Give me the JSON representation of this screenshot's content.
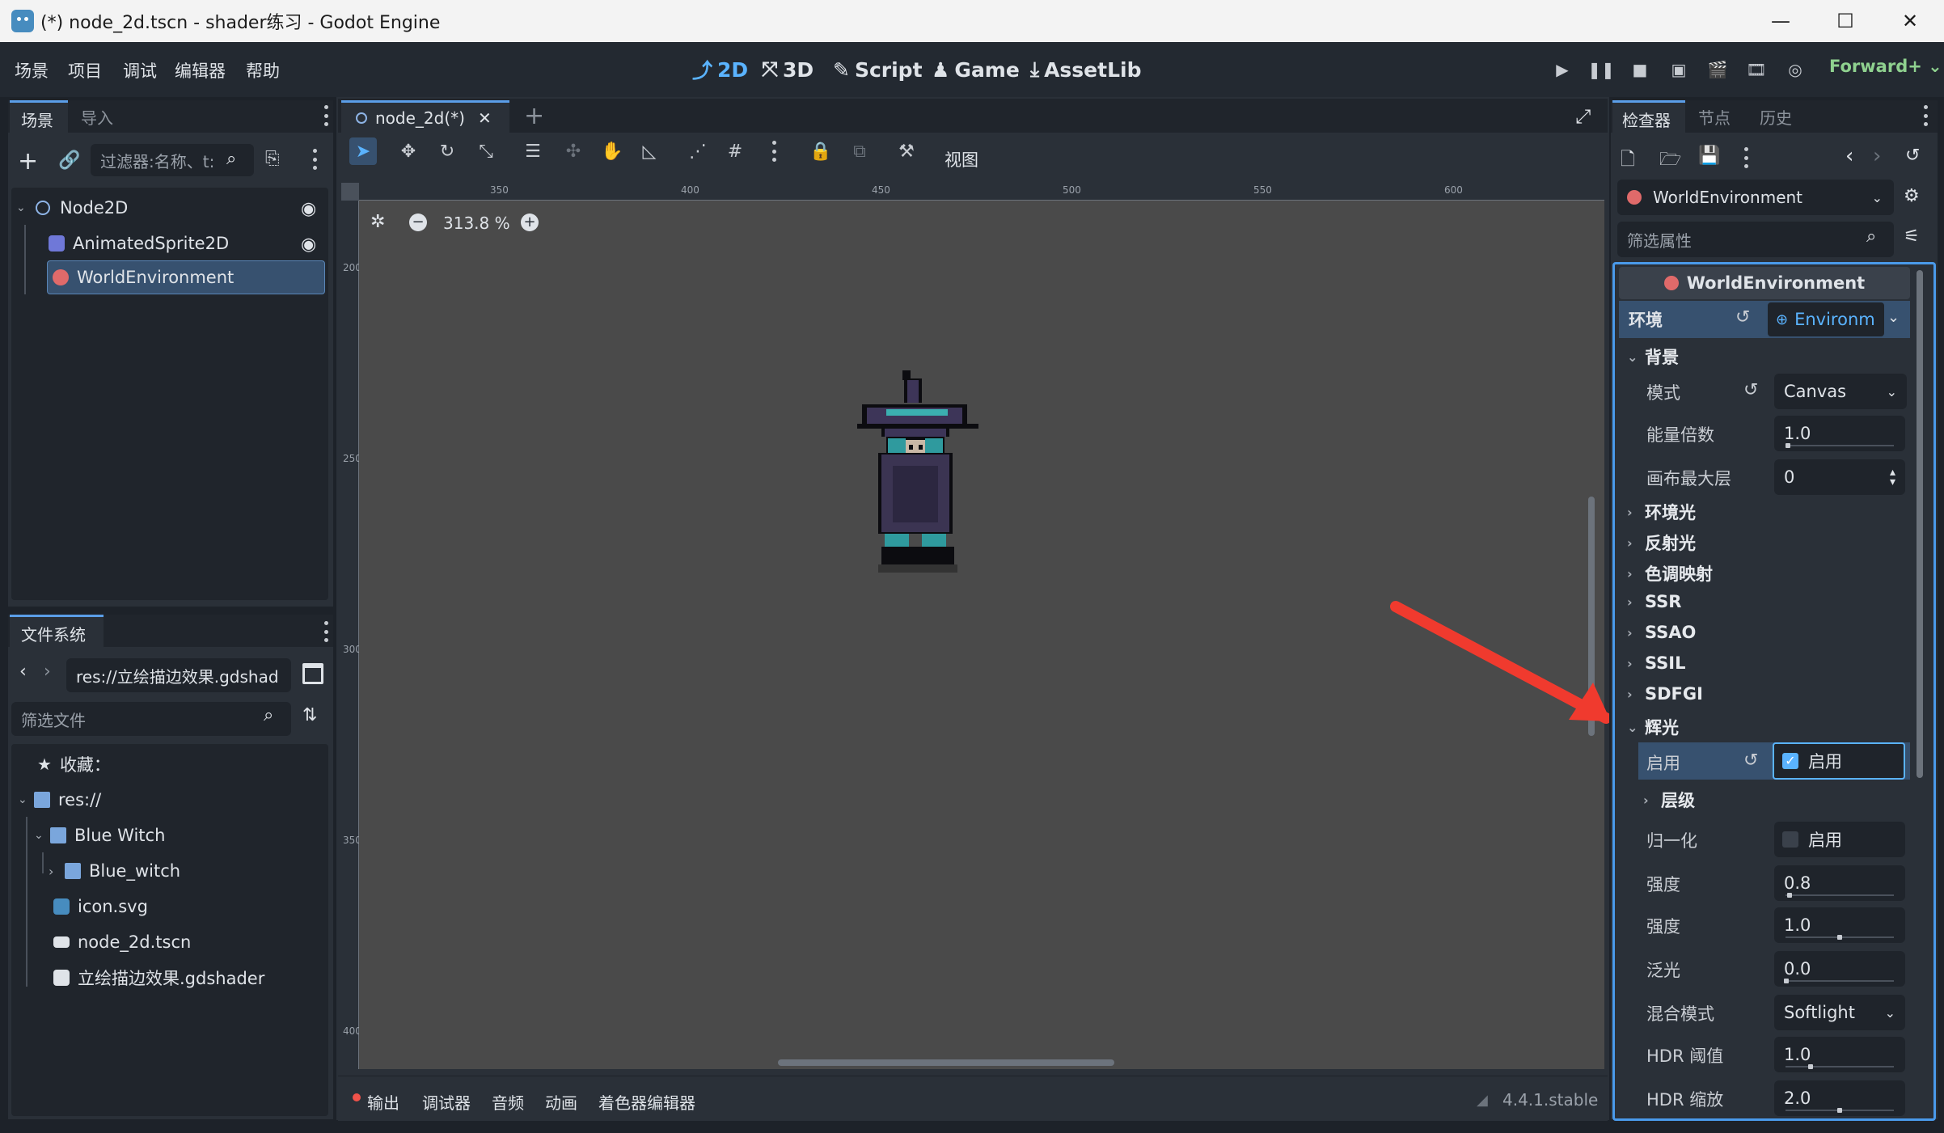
{
  "window": {
    "title": "(*) node_2d.tscn - shader练习 - Godot Engine"
  },
  "menu": {
    "items": [
      "场景",
      "项目",
      "调试",
      "编辑器",
      "帮助"
    ]
  },
  "workspaces": {
    "d2": "2D",
    "d3": "3D",
    "script": "Script",
    "game": "Game",
    "assetlib": "AssetLib"
  },
  "renderer": "Forward+",
  "scene_dock": {
    "tabs": [
      "场景",
      "导入"
    ],
    "filter_placeholder": "过滤器:名称、t:",
    "tree": [
      "Node2D",
      "AnimatedSprite2D",
      "WorldEnvironment"
    ],
    "selected": "WorldEnvironment"
  },
  "filesystem_dock": {
    "tab": "文件系统",
    "path": "res://立绘描边效果.gdshad",
    "filter_placeholder": "筛选文件",
    "favorites": "收藏：",
    "items": [
      "res://",
      "Blue Witch",
      "Blue_witch",
      "icon.svg",
      "node_2d.tscn",
      "立绘描边效果.gdshader"
    ]
  },
  "editor_tabs": {
    "scene_tab": "node_2d(*)"
  },
  "toolbar": {
    "view_label": "视图"
  },
  "viewport": {
    "zoom": "313.8 %",
    "ruler_h": [
      "350",
      "400",
      "450",
      "500",
      "550",
      "600"
    ],
    "ruler_v": [
      "200",
      "250",
      "300",
      "350",
      "400"
    ]
  },
  "bottom_panel": {
    "tabs": [
      "输出",
      "调试器",
      "音频",
      "动画",
      "着色器编辑器"
    ],
    "version": "4.4.1.stable"
  },
  "inspector": {
    "tabs": [
      "检查器",
      "节点",
      "历史"
    ],
    "object": "WorldEnvironment",
    "filter_placeholder": "筛选属性",
    "header": "WorldEnvironment",
    "environment_label": "环境",
    "environment_value": "Environm",
    "sections": {
      "background": "背景",
      "ambient": "环境光",
      "reflected": "反射光",
      "tonemap": "色调映射",
      "ssr": "SSR",
      "ssao": "SSAO",
      "ssil": "SSIL",
      "sdfgi": "SDFGI",
      "glow": "辉光",
      "levels": "层级"
    },
    "bg_mode_label": "模式",
    "bg_mode_value": "Canvas",
    "energy_label": "能量倍数",
    "energy_value": "1.0",
    "canvas_max_layer_label": "画布最大层",
    "canvas_max_layer_value": "0",
    "glow_enabled_label": "启用",
    "glow_enabled_value": "启用",
    "normalize_label": "归一化",
    "normalize_value": "启用",
    "intensity_label": "强度",
    "intensity_value": "0.8",
    "strength_label": "强度",
    "strength_value": "1.0",
    "bloom_label": "泛光",
    "bloom_value": "0.0",
    "blend_mode_label": "混合模式",
    "blend_mode_value": "Softlight",
    "hdr_threshold_label": "HDR 阈值",
    "hdr_threshold_value": "1.0",
    "hdr_scale_label": "HDR 缩放",
    "hdr_scale_value": "2.0"
  },
  "colors": {
    "accent": "#5ab3ff",
    "renderer": "#8fd18f",
    "arrow": "#f03a2e",
    "selection": "#37516f"
  }
}
